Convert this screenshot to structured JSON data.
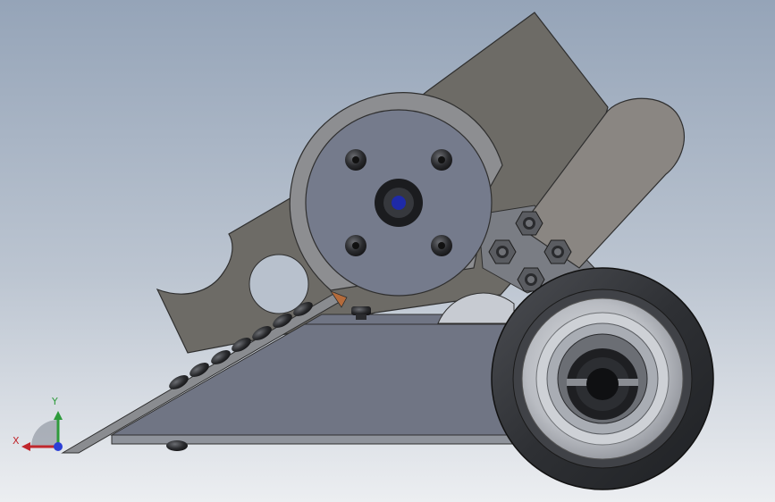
{
  "viewport": {
    "background_top": "#95a4b8",
    "background_bottom": "#eceef1"
  },
  "triad": {
    "x_label": "X",
    "y_label": "Y",
    "x_color": "#c0272d",
    "y_color": "#2e9b3c",
    "z_color": "#2b3fd6"
  },
  "model": {
    "parts": [
      "rear-weapon-plate",
      "top-guard-plate",
      "drive-pulley",
      "pulley-hub",
      "hub-bolt",
      "wedge-plate",
      "chassis-side-plate",
      "base-plate",
      "arm-link",
      "mounting-bracket",
      "hex-nut",
      "drive-wheel",
      "wheel-hub"
    ]
  }
}
